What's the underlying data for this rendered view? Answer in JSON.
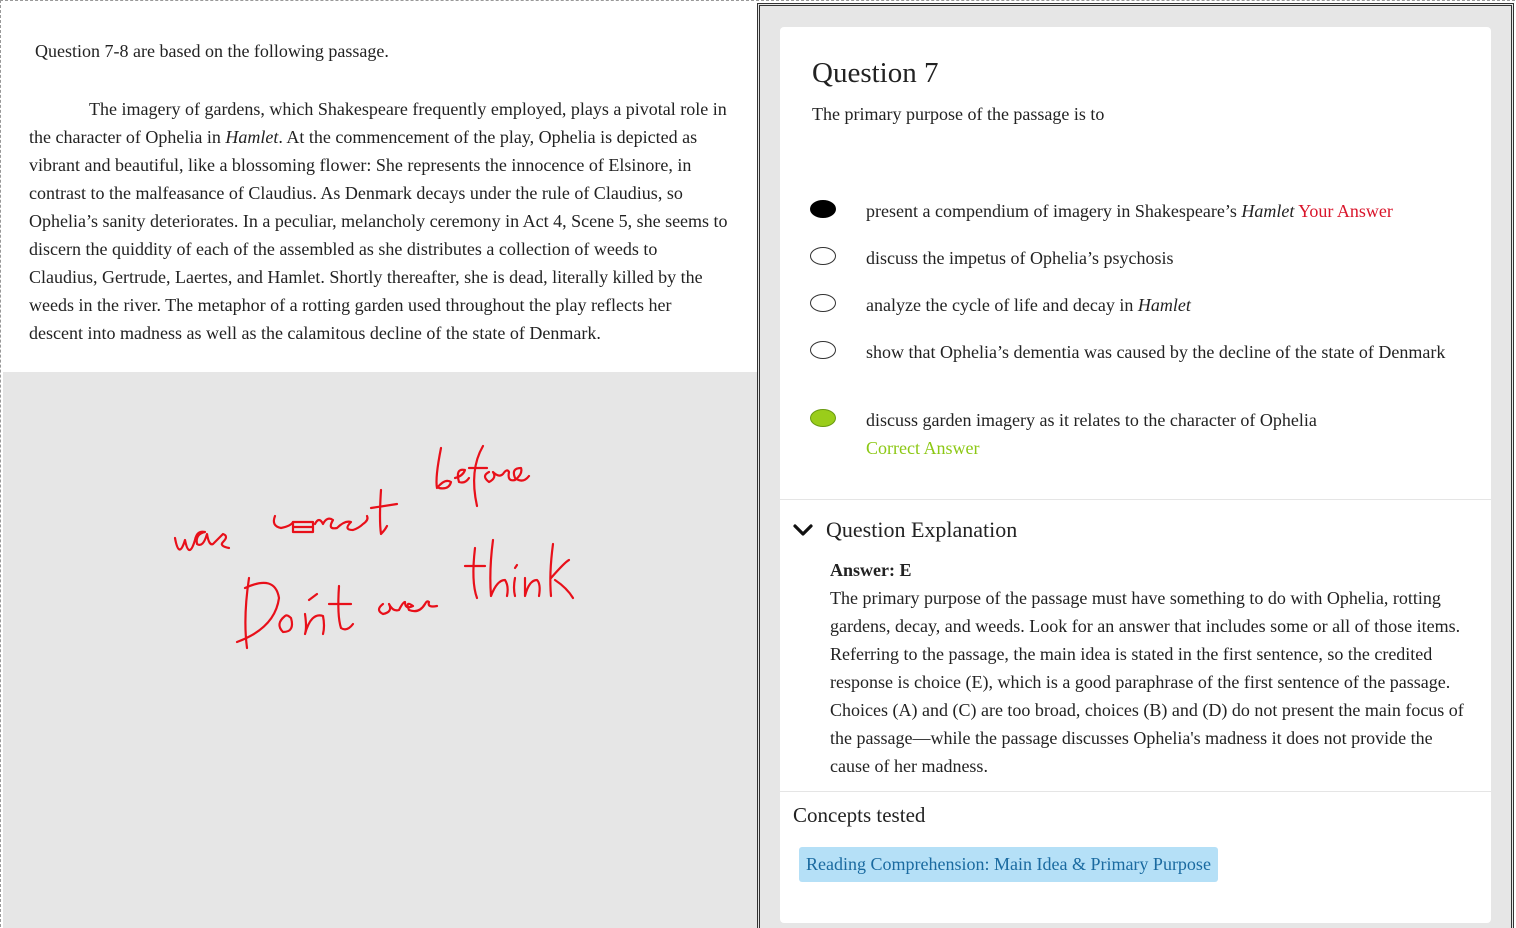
{
  "passage": {
    "intro": "Question 7-8 are based on the following passage.",
    "text_1": "The imagery of gardens, which Shakespeare frequently employed, plays a pivotal role in the character of Ophelia in ",
    "text_italic": "Hamlet",
    "text_2": ". At the commencement of the play, Ophelia is depicted as vibrant and beautiful, like a blossoming flower: She represents the innocence of Elsinore, in contrast to the malfeasance of Claudius. As Denmark decays under the rule of Claudius, so Ophelia’s sanity deteriorates. In a peculiar, melancholy ceremony in Act 4, Scene 5, she seems to discern the quiddity of each of the assembled as she distributes a collection of weeds to Claudius, Gertrude, Laertes, and Hamlet. Shortly thereafter, she is dead, literally killed by the weeds in the river. The metaphor of a rotting garden used throughout the play reflects her descent into madness as well as the calamitous decline of the state of Denmark."
  },
  "handwriting": {
    "line1": "was correct before",
    "line2": "Don't over think",
    "color": "#e8101a"
  },
  "question": {
    "title": "Question 7",
    "stem": "The primary purpose of the passage is to",
    "choices": [
      {
        "text": "present a compendium of imagery in Shakespeare’s ",
        "italic": "Hamlet",
        "tag": "Your Answer",
        "state": "selected"
      },
      {
        "text": "discuss the impetus of Ophelia’s psychosis",
        "state": "empty"
      },
      {
        "text": "analyze the cycle of life and decay in ",
        "italic": "Hamlet",
        "state": "empty"
      },
      {
        "text": "show that Ophelia’s dementia was caused by the decline of the state of Denmark",
        "state": "empty"
      },
      {
        "text": "discuss garden imagery as it relates to the character of Ophelia",
        "tag": "Correct Answer",
        "state": "correct"
      }
    ]
  },
  "explanation": {
    "heading": "Question Explanation",
    "answer_label": "Answer: E",
    "body": "The primary purpose of the passage must have something to do with Ophelia, rotting gardens, decay, and weeds. Look for an answer that includes some or all of those items. Referring to the passage, the main idea is stated in the first sentence, so the credited response is choice (E), which is a good paraphrase of the first sentence of the passage. Choices (A) and (C) are too broad, choices (B) and (D) do not present the main focus of the passage—while the passage discusses Ophelia's madness it does not provide the cause of her madness."
  },
  "concepts": {
    "title": "Concepts tested",
    "tag": "Reading Comprehension: Main Idea & Primary Purpose"
  },
  "colors": {
    "your_answer": "#d9142a",
    "correct_answer": "#8cc814",
    "concept_tag_bg": "#b5e0f7"
  }
}
